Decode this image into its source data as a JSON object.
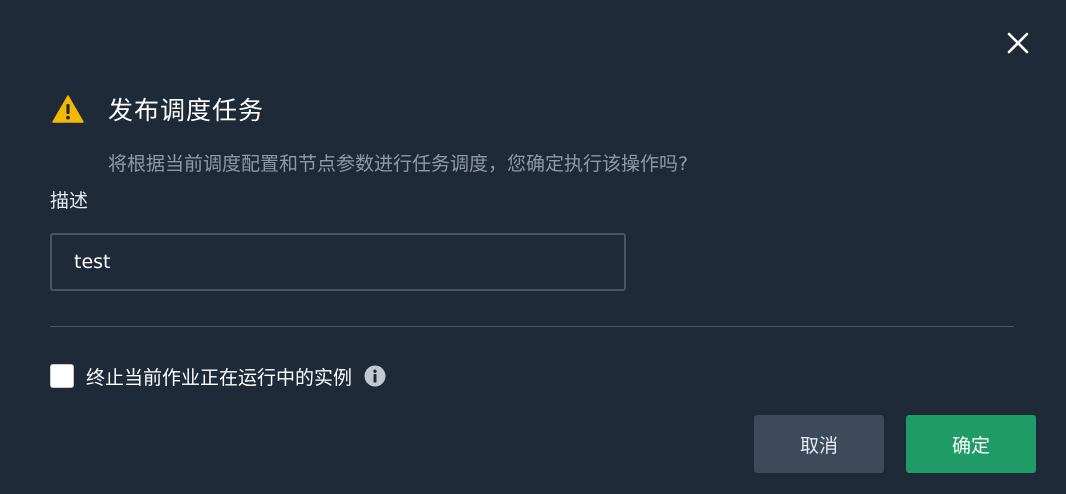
{
  "dialog": {
    "title": "发布调度任务",
    "message": "将根据当前调度配置和节点参数进行任务调度，您确定执行该操作吗?",
    "description_label": "描述",
    "description_value": "test",
    "terminate_checkbox_label": "终止当前作业正在运行中的实例",
    "terminate_checked": false,
    "cancel_label": "取消",
    "confirm_label": "确定",
    "icons": {
      "close": "close-icon",
      "warning": "warning-icon",
      "info": "info-icon"
    }
  },
  "colors": {
    "background": "#1f2a38",
    "warning": "#f5b800",
    "primary": "#1e9b67",
    "secondary": "#3c4a5c"
  }
}
